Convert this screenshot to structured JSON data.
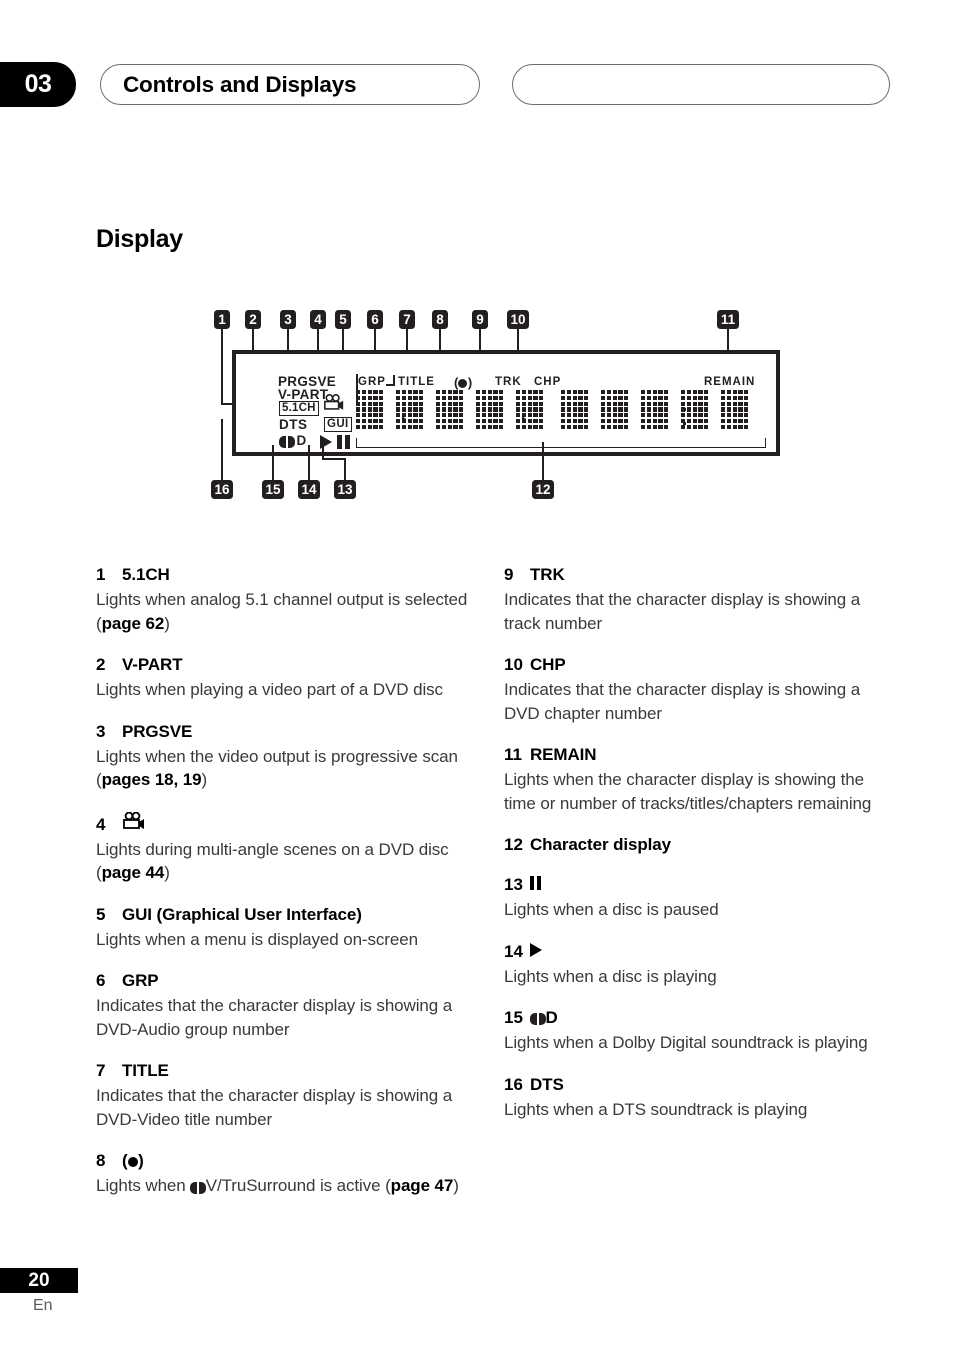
{
  "header": {
    "chapter_number": "03",
    "title": "Controls and Displays",
    "right_pill_label": ""
  },
  "section": {
    "heading": "Display"
  },
  "diagram": {
    "name": "front-panel-display",
    "callouts_top": [
      "1",
      "2",
      "3",
      "4",
      "5",
      "6",
      "7",
      "8",
      "9",
      "10",
      "11"
    ],
    "callouts_bottom": [
      "16",
      "15",
      "14",
      "13",
      "12"
    ],
    "panel_indicators": {
      "prgsve": "PRGSVE",
      "v_part": "V-PART",
      "five_one_ch": "5.1CH",
      "dts": "DTS",
      "gui": "GUI",
      "dolby_suffix": "D",
      "angle_icon": "video-camera-icon",
      "play_icon": "play-icon",
      "pause_icon": "pause-icon"
    },
    "matrix_labels": {
      "grp": "GRP",
      "title": "TITLE",
      "trusurround": "(●)",
      "trk": "TRK",
      "chp": "CHP",
      "remain": "REMAIN"
    },
    "character_cells": 10
  },
  "items_left": [
    {
      "num": "1",
      "label": "5.1CH",
      "icon": null,
      "body_parts": [
        {
          "text": "Lights when analog 5.1 channel output is selected ("
        },
        {
          "text": "page 62",
          "bold": true
        },
        {
          "text": ")"
        }
      ]
    },
    {
      "num": "2",
      "label": "V-PART",
      "icon": null,
      "body_parts": [
        {
          "text": "Lights when playing a video part of a DVD disc"
        }
      ]
    },
    {
      "num": "3",
      "label": "PRGSVE",
      "icon": null,
      "body_parts": [
        {
          "text": "Lights when the video output is progressive scan ("
        },
        {
          "text": "pages 18, 19",
          "bold": true
        },
        {
          "text": ")"
        }
      ]
    },
    {
      "num": "4",
      "label": "",
      "icon": "video-camera-icon",
      "body_parts": [
        {
          "text": "Lights during multi-angle scenes on a DVD disc ("
        },
        {
          "text": "page 44",
          "bold": true
        },
        {
          "text": ")"
        }
      ]
    },
    {
      "num": "5",
      "label": "GUI  (Graphical User Interface)",
      "icon": null,
      "body_parts": [
        {
          "text": "Lights when a menu is displayed on-screen"
        }
      ]
    },
    {
      "num": "6",
      "label": "GRP",
      "icon": null,
      "body_parts": [
        {
          "text": "Indicates that the character display is showing a DVD-Audio group number"
        }
      ]
    },
    {
      "num": "7",
      "label": "TITLE",
      "icon": null,
      "body_parts": [
        {
          "text": "Indicates that the character display is showing a DVD-Video title number"
        }
      ]
    },
    {
      "num": "8",
      "label": "",
      "icon": "trusurround-icon",
      "body_parts": [
        {
          "text": "Lights when "
        },
        {
          "text": "dolby-icon",
          "icon": true
        },
        {
          "text": "V/TruSurround is active ("
        },
        {
          "text": "page 47",
          "bold": true
        },
        {
          "text": ")"
        }
      ]
    }
  ],
  "items_right": [
    {
      "num": "9",
      "label": "TRK",
      "icon": null,
      "body_parts": [
        {
          "text": "Indicates that the character display is showing a track number"
        }
      ]
    },
    {
      "num": "10",
      "label": "CHP",
      "icon": null,
      "body_parts": [
        {
          "text": "Indicates that the character display is showing a DVD chapter number"
        }
      ]
    },
    {
      "num": "11",
      "label": "REMAIN",
      "icon": null,
      "body_parts": [
        {
          "text": "Lights when the character display is showing the time or number of tracks/titles/chapters remaining"
        }
      ]
    },
    {
      "num": "12",
      "label": "Character display",
      "icon": null,
      "body_parts": []
    },
    {
      "num": "13",
      "label": "",
      "icon": "pause-icon",
      "body_parts": [
        {
          "text": "Lights when a disc is paused"
        }
      ]
    },
    {
      "num": "14",
      "label": "",
      "icon": "play-icon",
      "body_parts": [
        {
          "text": "Lights when a disc is playing"
        }
      ]
    },
    {
      "num": "15",
      "label": "D",
      "icon": "dolby-icon",
      "body_parts": [
        {
          "text": "Lights when a Dolby Digital soundtrack is playing"
        }
      ]
    },
    {
      "num": "16",
      "label": "DTS",
      "icon": null,
      "body_parts": [
        {
          "text": "Lights when a DTS soundtrack is playing"
        }
      ]
    }
  ],
  "footer": {
    "page_number": "20",
    "language": "En"
  }
}
